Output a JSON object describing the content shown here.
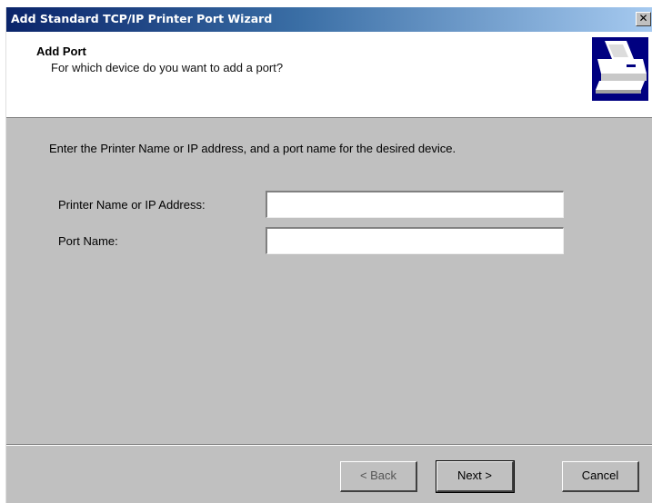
{
  "window": {
    "title": "Add Standard TCP/IP Printer Port Wizard",
    "close_glyph": "✕"
  },
  "header": {
    "title": "Add Port",
    "subtitle": "For which device do you want to add a port?",
    "icon": "printer-icon"
  },
  "content": {
    "instruction": "Enter the Printer Name or IP address, and a port name for the desired device.",
    "fields": [
      {
        "label": "Printer Name or IP Address:",
        "value": ""
      },
      {
        "label": "Port Name:",
        "value": ""
      }
    ]
  },
  "buttons": {
    "back": "< Back",
    "next": "Next >",
    "cancel": "Cancel"
  },
  "colors": {
    "titlebar_start": "#0a246a",
    "titlebar_end": "#a6caf0",
    "dialog_bg": "#c0c0c0"
  }
}
